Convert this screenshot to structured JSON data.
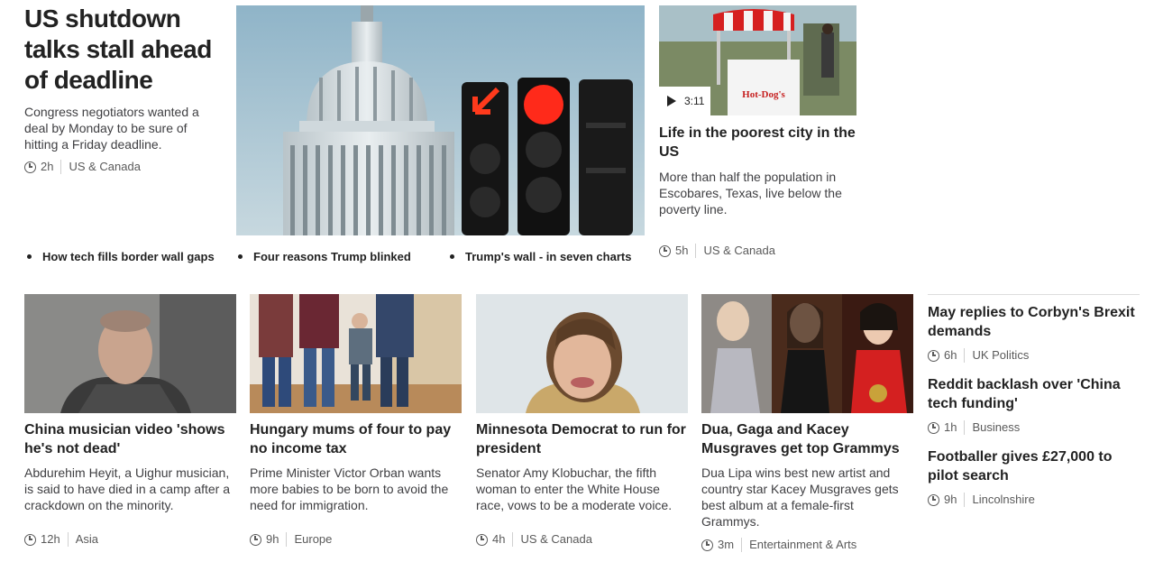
{
  "top_story": {
    "headline": "US shutdown talks stall ahead of deadline",
    "summary": "Congress negotiators wanted a deal by Monday to be sure of hitting a Friday deadline.",
    "time": "2h",
    "section": "US & Canada",
    "image": "capitol-traffic-lights",
    "related": [
      "How tech fills border wall gaps",
      "Four reasons Trump blinked",
      "Trump's wall - in seven charts"
    ]
  },
  "video_story": {
    "duration": "3:11",
    "image_sign": "Hot-Dog's",
    "headline": "Life in the poorest city in the US",
    "summary": "More than half the population in Escobares, Texas, live below the poverty line.",
    "time": "5h",
    "section": "US & Canada"
  },
  "cards": [
    {
      "headline": "China musician video 'shows he's not dead'",
      "summary": "Abdurehim Heyit, a Uighur musician, is said to have died in a camp after a crackdown on the minority.",
      "time": "12h",
      "section": "Asia"
    },
    {
      "headline": "Hungary mums of four to pay no income tax",
      "summary": "Prime Minister Victor Orban wants more babies to be born to avoid the need for immigration.",
      "time": "9h",
      "section": "Europe"
    },
    {
      "headline": "Minnesota Democrat to run for president",
      "summary": "Senator Amy Klobuchar, the fifth woman to enter the White House race, vows to be a moderate voice.",
      "time": "4h",
      "section": "US & Canada"
    },
    {
      "headline": "Dua, Gaga and Kacey Musgraves get top Grammys",
      "summary": "Dua Lipa wins best new artist and country star Kacey Musgraves gets best album at a female-first Grammys.",
      "time": "3m",
      "section": "Entertainment & Arts"
    }
  ],
  "right_column": [
    {
      "headline": "May replies to Corbyn's Brexit demands",
      "time": "6h",
      "section": "UK Politics"
    },
    {
      "headline": "Reddit backlash over 'China tech funding'",
      "time": "1h",
      "section": "Business"
    },
    {
      "headline": "Footballer gives £27,000 to pilot search",
      "time": "9h",
      "section": "Lincolnshire"
    }
  ],
  "colors": {
    "text": "#222222",
    "meta": "#5a5a5a",
    "traffic_red": "#ff2a1a"
  }
}
